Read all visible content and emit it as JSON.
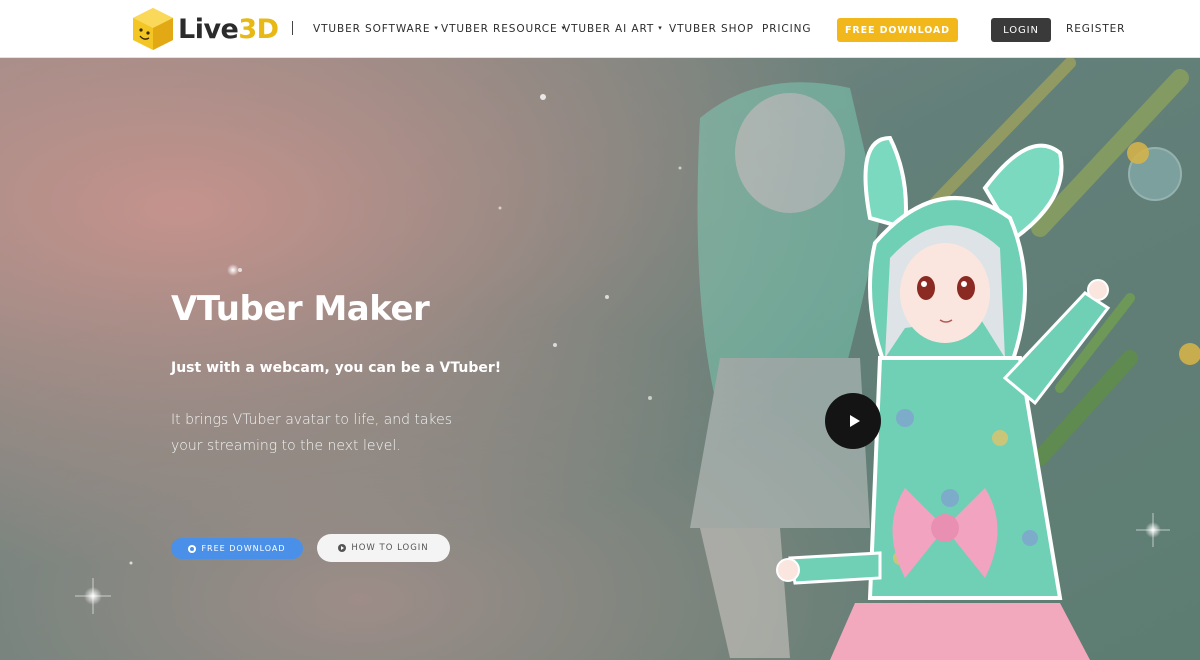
{
  "header": {
    "logo": {
      "text_main": "Live",
      "text_accent": "3D",
      "icon": "smiley-cube-icon"
    },
    "nav": [
      {
        "label": "VTUBER SOFTWARE",
        "has_dropdown": true
      },
      {
        "label": "VTUBER RESOURCE",
        "has_dropdown": true
      },
      {
        "label": "VTUBER AI ART",
        "has_dropdown": true
      },
      {
        "label": "VTUBER SHOP",
        "has_dropdown": false
      },
      {
        "label": "PRICING",
        "has_dropdown": false
      }
    ],
    "free_download_label": "FREE DOWNLOAD",
    "login_label": "LOGIN",
    "register_label": "REGISTER",
    "colors": {
      "free_download": "#f2b81b",
      "login": "#3a3a3a"
    }
  },
  "hero": {
    "title": "VTuber Maker",
    "subtitle": "Just with a webcam, you can be a VTuber!",
    "description": "It brings VTuber avatar to life, and takes your streaming to the next level.",
    "cta_download_label": "FREE DOWNLOAD",
    "cta_login_label": "HOW TO LOGIN",
    "play_icon": "play-icon",
    "colors": {
      "cta_download": "#4a90e8",
      "background": "#5f7f78"
    }
  }
}
